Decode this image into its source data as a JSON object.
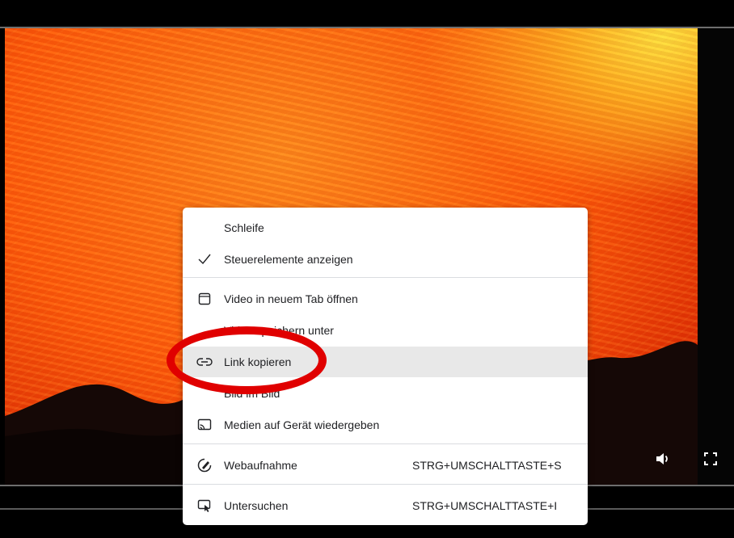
{
  "player": {
    "controls": {
      "volume_icon": "speaker-icon",
      "fullscreen_icon": "fullscreen-icon"
    }
  },
  "context_menu": {
    "items": [
      {
        "label": "Schleife",
        "icon": "",
        "shortcut": ""
      },
      {
        "label": "Steuerelemente anzeigen",
        "icon": "checkmark-icon",
        "shortcut": ""
      },
      {
        "label": "Video in neuem Tab öffnen",
        "icon": "new-tab-icon",
        "shortcut": ""
      },
      {
        "label": "Video speichern unter",
        "icon": "",
        "shortcut": ""
      },
      {
        "label": "Link kopieren",
        "icon": "link-icon",
        "shortcut": ""
      },
      {
        "label": "Bild im Bild",
        "icon": "",
        "shortcut": ""
      },
      {
        "label": "Medien auf Gerät wiedergeben",
        "icon": "cast-icon",
        "shortcut": ""
      },
      {
        "label": "Webaufnahme",
        "icon": "web-capture-icon",
        "shortcut": "STRG+UMSCHALTTASTE+S"
      },
      {
        "label": "Untersuchen",
        "icon": "inspect-icon",
        "shortcut": "STRG+UMSCHALTTASTE+I"
      }
    ],
    "highlighted_item": "Link kopieren"
  },
  "colors": {
    "annotation_ring": "#e00000",
    "menu_highlight": "#e8e8e8",
    "lava": "#ff5a0a"
  }
}
